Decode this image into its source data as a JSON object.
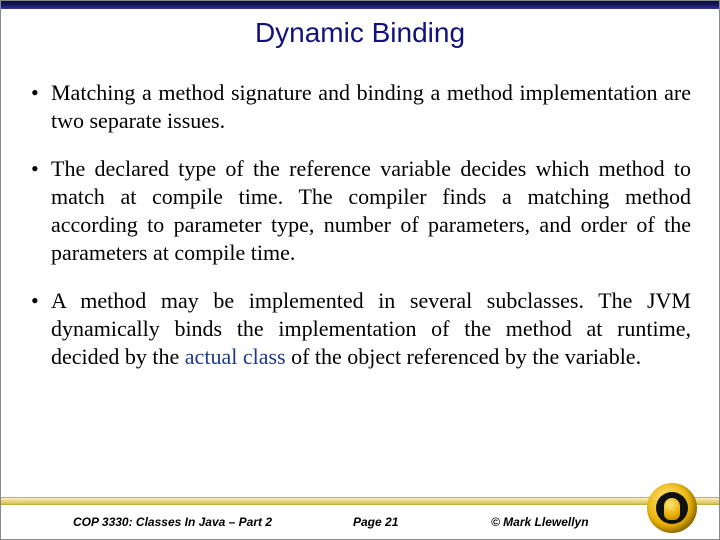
{
  "title": "Dynamic Binding",
  "bullets": {
    "b1": "Matching a method signature and binding a method implementation are two separate issues.",
    "b2": "The declared type of the reference variable decides which method to match at compile time.  The compiler finds a matching method according to  parameter type, number of parameters, and order of the parameters at compile time.",
    "b3_pre": "A method may be implemented in several subclasses.  The JVM dynamically binds the implementation of the method at runtime, decided by the ",
    "b3_kw": "actual class",
    "b3_post": " of the object referenced by the variable."
  },
  "footer": {
    "course": "COP 3330: Classes In Java – Part 2",
    "page": "Page 21",
    "copyright": "© Mark Llewellyn"
  }
}
